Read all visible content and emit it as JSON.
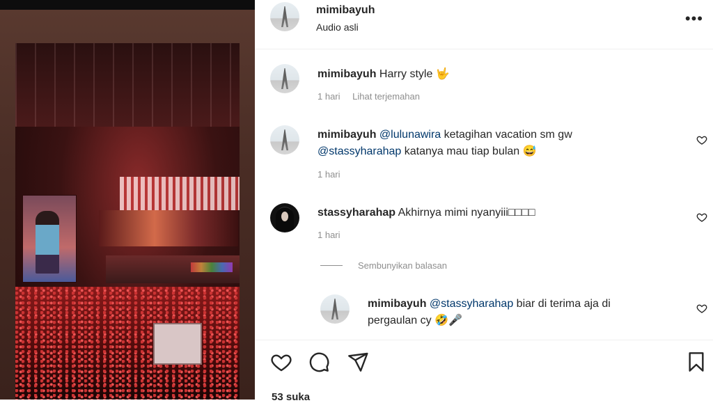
{
  "post": {
    "username": "mimibayuh",
    "audio_label": "Audio asli",
    "more_icon": "more-options-icon"
  },
  "caption": {
    "username": "mimibayuh",
    "text": "Harry style",
    "emoji": "🤟",
    "time": "1 hari",
    "translate": "Lihat terjemahan"
  },
  "comments": [
    {
      "username": "mimibayuh",
      "mention1": "@lulunawira",
      "text1": " ketagihan vacation sm gw",
      "mention2": "@stassyharahap",
      "text2": " katanya mau tiap bulan",
      "emoji": "😅",
      "time": "1 hari"
    },
    {
      "username": "stassyharahap",
      "text": "Akhirnya mimi nyanyiii□□□□",
      "time": "1 hari",
      "hide_replies": "Sembunyikan balasan"
    }
  ],
  "reply": {
    "username": "mimibayuh",
    "mention": "@stassyharahap",
    "text1": " biar di terima aja di",
    "text2": "pergaulan cy",
    "emoji1": "🤣",
    "emoji2": "🎤"
  },
  "footer": {
    "likes": "53 suka"
  }
}
